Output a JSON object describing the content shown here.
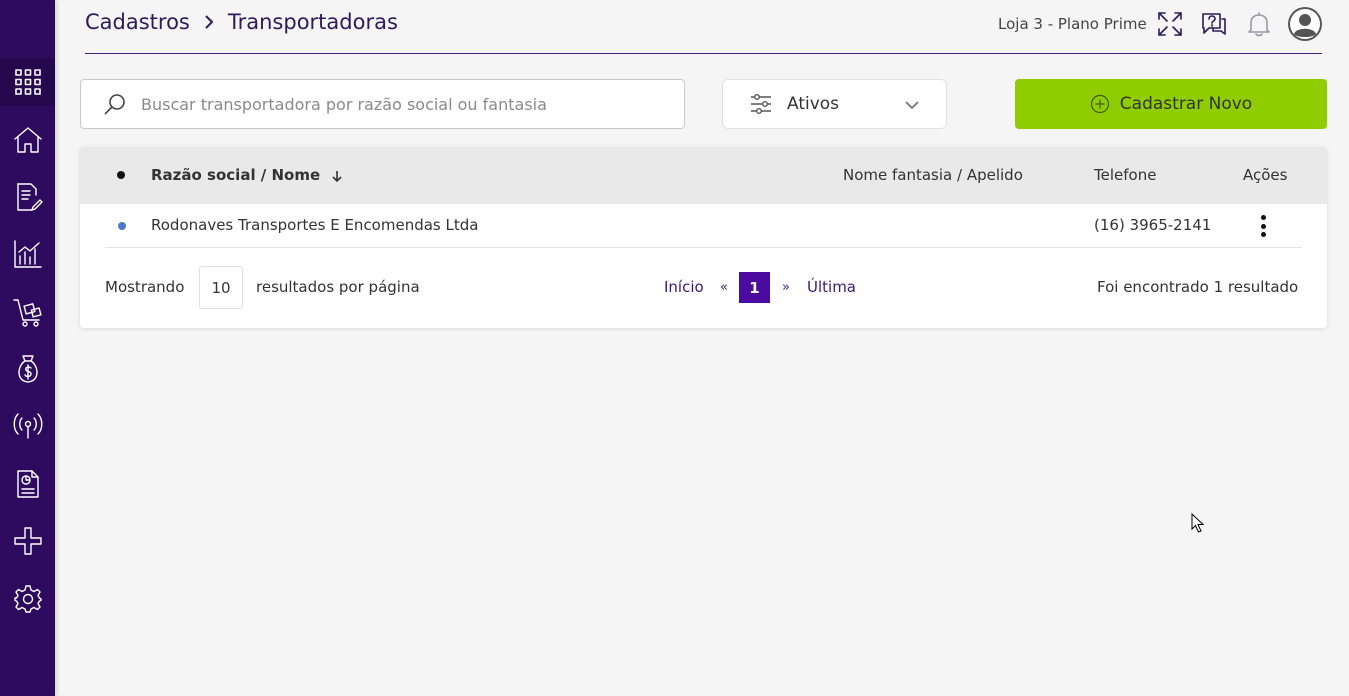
{
  "header": {
    "breadcrumb": [
      "Cadastros",
      "Transportadoras"
    ],
    "store_label": "Loja 3 - Plano Prime"
  },
  "sidebar": {
    "items": [
      {
        "icon": "apps-grid-icon"
      },
      {
        "icon": "home-icon"
      },
      {
        "icon": "document-edit-icon"
      },
      {
        "icon": "chart-icon"
      },
      {
        "icon": "cart-icon"
      },
      {
        "icon": "money-bag-icon"
      },
      {
        "icon": "broadcast-icon"
      },
      {
        "icon": "report-icon"
      },
      {
        "icon": "integration-icon"
      },
      {
        "icon": "gear-icon"
      }
    ]
  },
  "toolbar": {
    "search_placeholder": "Buscar transportadora por razão social ou fantasia",
    "search_value": "",
    "filter_selected": "Ativos",
    "new_button_label": "Cadastrar Novo"
  },
  "table": {
    "columns": {
      "name": "Razão social / Nome",
      "fantasy": "Nome fantasia / Apelido",
      "phone": "Telefone",
      "actions": "Ações"
    },
    "rows": [
      {
        "name": "Rodonaves Transportes E Encomendas Ltda",
        "fantasy": "",
        "phone": "(16) 3965-2141",
        "status_color": "#4d7bc8"
      }
    ]
  },
  "pagination": {
    "showing_label": "Mostrando",
    "per_page": "10",
    "per_page_suffix": "resultados por página",
    "first": "Início",
    "prev": "«",
    "current": "1",
    "next": "»",
    "last": "Última",
    "result_text": "Foi encontrado 1 resultado"
  },
  "colors": {
    "sidebar": "#2e0a5e",
    "primary": "#4b0aa0",
    "accent_green": "#8fcc00"
  }
}
